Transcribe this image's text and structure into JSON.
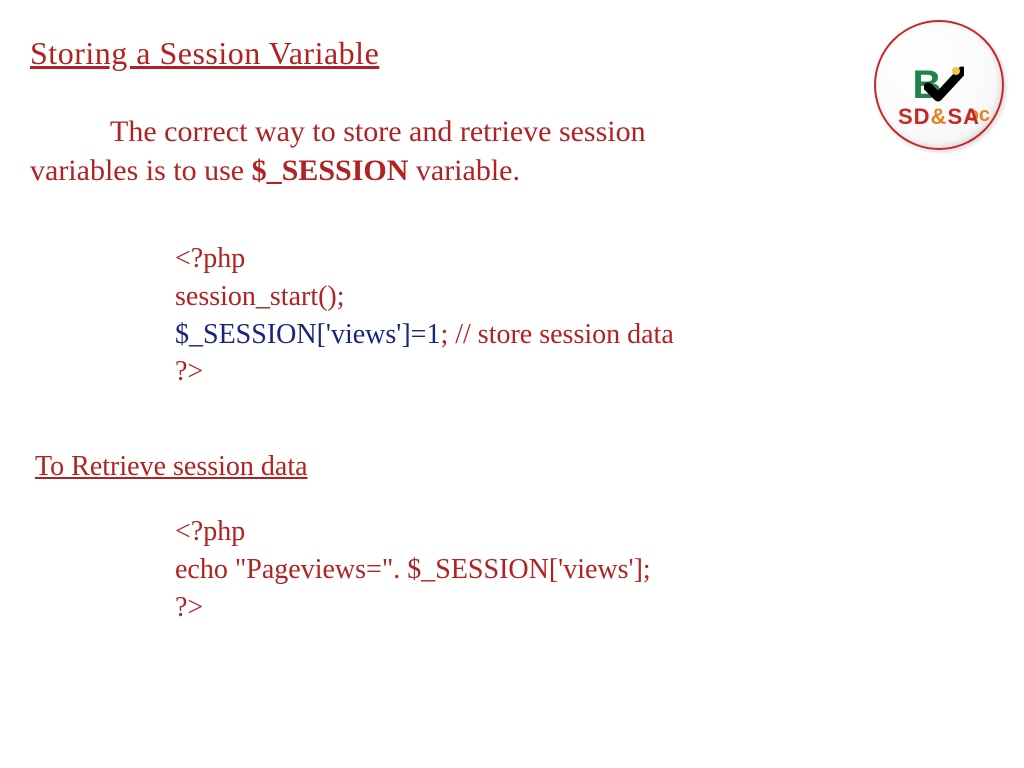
{
  "title": "Storing a Session Variable",
  "body": {
    "line1_prefix": "The correct way to store and retrieve session",
    "line2_prefix": "variables is to use  ",
    "session_var": "$_SESSION",
    "line2_suffix": " variable."
  },
  "code1": {
    "l1": "<?php",
    "l2": "session_start();",
    "l3_blue": "$_SESSION['views']=1",
    "l3_rest": "; // store session data",
    "l4": "?>"
  },
  "subtitle": "To Retrieve  session data",
  "code2": {
    "l1": "<?php",
    "l2": "echo \"Pageviews=\". $_SESSION['views'];",
    "l3": "?>"
  },
  "logo": {
    "letter_b": "B",
    "voc": "oc",
    "sd": "SD",
    "amp": "&",
    "sa": "SA"
  }
}
